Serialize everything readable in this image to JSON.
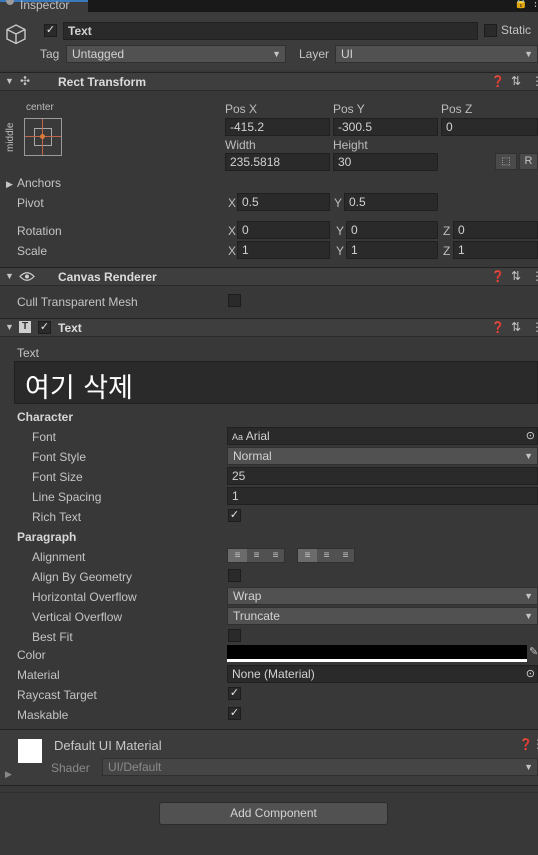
{
  "tab": {
    "label": "Inspector"
  },
  "object": {
    "name": "Text",
    "static_label": "Static",
    "tag_label": "Tag",
    "tag_value": "Untagged",
    "layer_label": "Layer",
    "layer_value": "UI"
  },
  "rect": {
    "title": "Rect Transform",
    "anchor_h": "center",
    "anchor_v": "middle",
    "posx_label": "Pos X",
    "posx": "-415.2",
    "posy_label": "Pos Y",
    "posy": "-300.5",
    "posz_label": "Pos Z",
    "posz": "0",
    "width_label": "Width",
    "width": "235.5818",
    "height_label": "Height",
    "height": "30",
    "r_label": "R",
    "anchors_label": "Anchors",
    "pivot_label": "Pivot",
    "pivot_x": "0.5",
    "pivot_y": "0.5",
    "rotation_label": "Rotation",
    "rot_x": "0",
    "rot_y": "0",
    "rot_z": "0",
    "scale_label": "Scale",
    "scale_x": "1",
    "scale_y": "1",
    "scale_z": "1",
    "x": "X",
    "y": "Y",
    "z": "Z"
  },
  "canvas": {
    "title": "Canvas Renderer",
    "cull_label": "Cull Transparent Mesh"
  },
  "text": {
    "title": "Text",
    "text_label": "Text",
    "content": "여기 삭제",
    "character_label": "Character",
    "font_label": "Font",
    "font_value": "Arial",
    "font_prefix": "Aa",
    "style_label": "Font Style",
    "style_value": "Normal",
    "size_label": "Font Size",
    "size_value": "25",
    "spacing_label": "Line Spacing",
    "spacing_value": "1",
    "rich_label": "Rich Text",
    "paragraph_label": "Paragraph",
    "alignment_label": "Alignment",
    "geometry_label": "Align By Geometry",
    "hover_label": "Horizontal Overflow",
    "hover_value": "Wrap",
    "vover_label": "Vertical Overflow",
    "vover_value": "Truncate",
    "bestfit_label": "Best Fit",
    "color_label": "Color",
    "color_value": "#000000",
    "material_label": "Material",
    "material_value": "None (Material)",
    "raycast_label": "Raycast Target",
    "maskable_label": "Maskable"
  },
  "material": {
    "name": "Default UI Material",
    "shader_label": "Shader",
    "shader_value": "UI/Default"
  },
  "add_component": "Add Component"
}
